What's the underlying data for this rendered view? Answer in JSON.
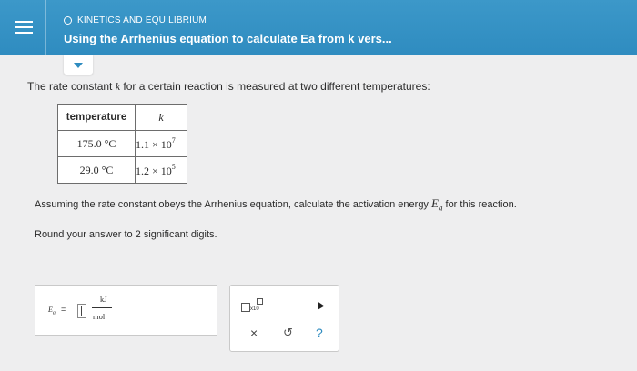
{
  "header": {
    "topic": "KINETICS AND EQUILIBRIUM",
    "title": "Using the Arrhenius equation to calculate Ea from k vers..."
  },
  "question": {
    "intro_before": "The rate constant ",
    "intro_var": "k",
    "intro_after": " for a certain reaction is measured at two different temperatures:",
    "table": {
      "headers": [
        "temperature",
        "k"
      ],
      "rows": [
        {
          "temperature": "175.0 °C",
          "k_mantissa": "1.1 × 10",
          "k_exp": "7"
        },
        {
          "temperature": "29.0 °C",
          "k_mantissa": "1.2 × 10",
          "k_exp": "5"
        }
      ]
    },
    "prompt_before": "Assuming the rate constant obeys the Arrhenius equation, calculate the activation energy ",
    "prompt_sym": "E",
    "prompt_sub": "a",
    "prompt_after": " for this reaction.",
    "round_before": "Round your answer to ",
    "round_num": "2",
    "round_after": " significant digits."
  },
  "answer": {
    "label_sym": "E",
    "label_sub": "a",
    "equals": "=",
    "value": "",
    "unit_numerator": "kJ",
    "unit_denominator": "mol"
  },
  "tools": {
    "sci_label": "x10",
    "clear": "×",
    "undo": "↺",
    "help": "?"
  },
  "colors": {
    "header_bg": "#2f8cc0",
    "accent": "#2f8cc0"
  }
}
